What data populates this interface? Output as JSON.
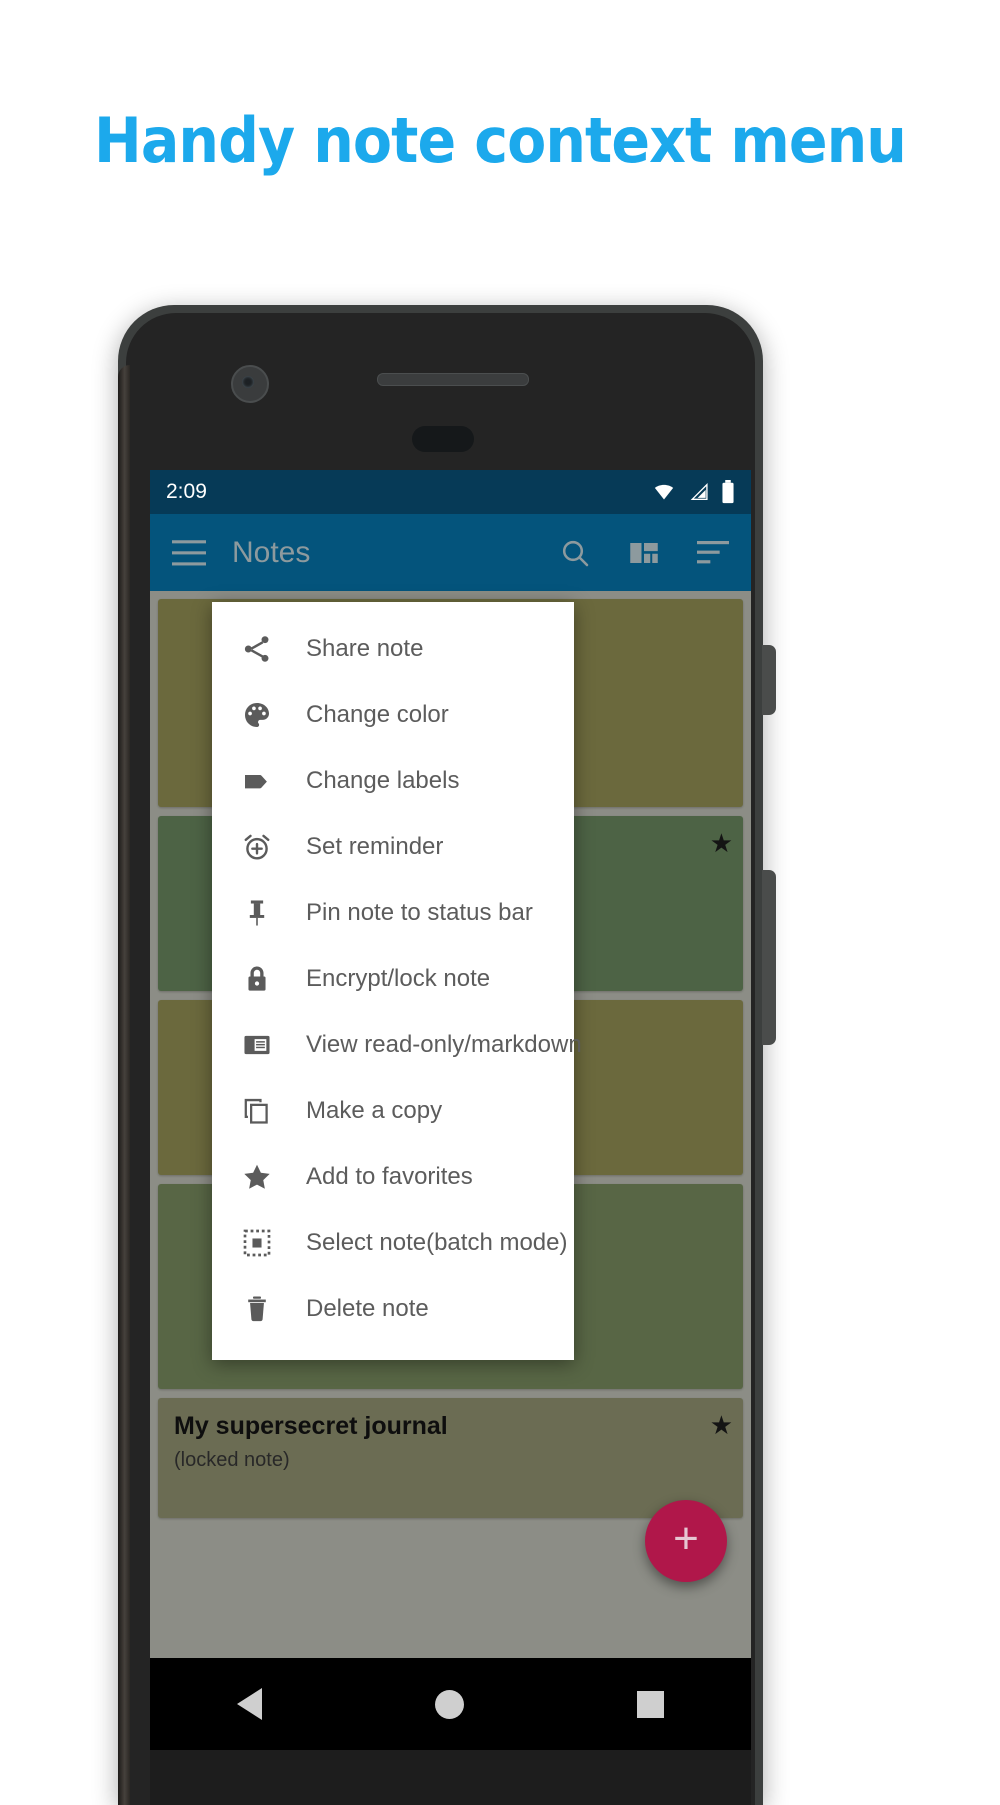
{
  "headline": {
    "text": "Handy note context menu"
  },
  "status_bar": {
    "time": "2:09",
    "icons": [
      {
        "name": "wifi-icon",
        "label": "wifi"
      },
      {
        "name": "signal-icon",
        "label": "cellular-signal"
      },
      {
        "name": "battery-icon",
        "label": "battery-full"
      }
    ],
    "background": "#063a57"
  },
  "app_bar": {
    "menu_icon": "hamburger-menu-icon",
    "title": "Notes",
    "actions": [
      {
        "name": "search-icon",
        "label": "Search"
      },
      {
        "name": "layout-grid-icon",
        "label": "Change layout"
      },
      {
        "name": "sort-icon",
        "label": "Sort"
      }
    ],
    "background": "#04547c",
    "title_color": "#8d9a9e"
  },
  "context_menu": {
    "items": [
      {
        "icon": "share-icon",
        "label": "Share note"
      },
      {
        "icon": "palette-icon",
        "label": "Change color"
      },
      {
        "icon": "tag-icon",
        "label": "Change labels"
      },
      {
        "icon": "alarm-add-icon",
        "label": "Set reminder"
      },
      {
        "icon": "pin-icon",
        "label": "Pin note to status bar"
      },
      {
        "icon": "lock-icon",
        "label": "Encrypt/lock note"
      },
      {
        "icon": "article-icon",
        "label": "View read-only/markdown"
      },
      {
        "icon": "copy-icon",
        "label": "Make a copy"
      },
      {
        "icon": "star-icon",
        "label": "Add to favorites"
      },
      {
        "icon": "select-box-icon",
        "label": "Select note(batch mode)"
      },
      {
        "icon": "trash-icon",
        "label": "Delete note"
      }
    ]
  },
  "notes": [
    {
      "title": "",
      "body": "",
      "color": "#9a9758",
      "starred": false
    },
    {
      "title": "",
      "body": "",
      "color": "#6f8f63",
      "starred": true
    },
    {
      "title": "",
      "body": "",
      "color": "#9a9758",
      "starred": false
    },
    {
      "title": "",
      "body": "",
      "color": "#7f9364",
      "starred": false
    },
    {
      "title": "My supersecret journal",
      "body": "(locked note)",
      "color": "#9a9b77",
      "starred": true
    }
  ],
  "fab": {
    "name": "add-note-fab",
    "label": "+",
    "color": "#b0174a"
  },
  "nav_bar": {
    "back": "back-button",
    "home": "home-button",
    "recents": "recents-button"
  }
}
